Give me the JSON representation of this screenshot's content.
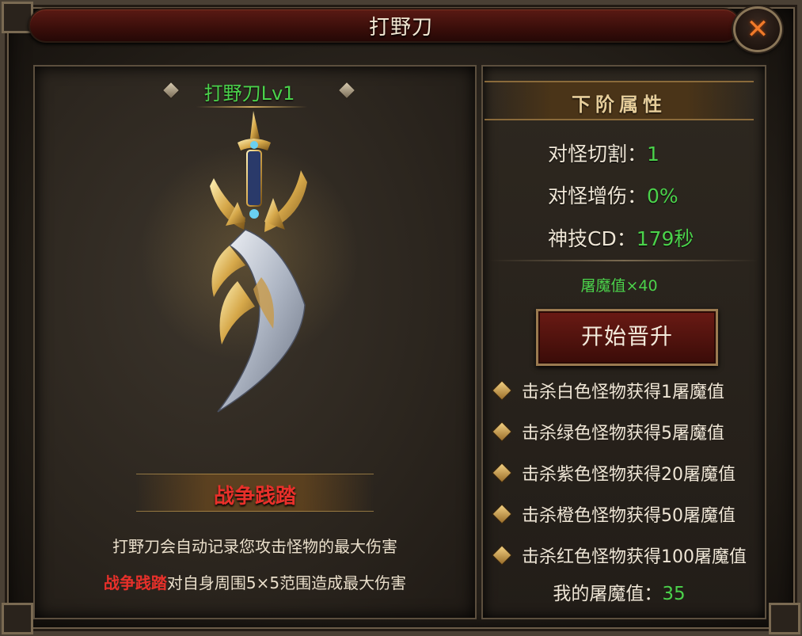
{
  "window": {
    "title": "打野刀"
  },
  "weapon": {
    "name": "打野刀Lv1"
  },
  "skill": {
    "name": "战争践踏",
    "desc_line1": "打野刀会自动记录您攻击怪物的最大伤害",
    "desc_line2_highlight": "战争践踏",
    "desc_line2_rest": "对自身周围5×5范围造成最大伤害"
  },
  "next_tier": {
    "header": "下阶属性",
    "stats": [
      {
        "label": "对怪切割：",
        "value": "1"
      },
      {
        "label": "对怪增伤：",
        "value": "0%"
      },
      {
        "label": "神技CD：",
        "value": "179秒"
      }
    ],
    "cost": "屠魔值×40",
    "upgrade_button": "开始晋升"
  },
  "rules": [
    "击杀白色怪物获得1屠魔值",
    "击杀绿色怪物获得5屠魔值",
    "击杀紫色怪物获得20屠魔值",
    "击杀橙色怪物获得50屠魔值",
    "击杀红色怪物获得100屠魔值"
  ],
  "my_value": {
    "label": "我的屠魔值：",
    "value": "35"
  },
  "icons": {
    "close": "close-icon",
    "rule_bullet": "diamond-bullet-icon"
  },
  "colors": {
    "green": "#4bd24b",
    "red": "#e8302a",
    "title_bar": "#5a1a14"
  }
}
